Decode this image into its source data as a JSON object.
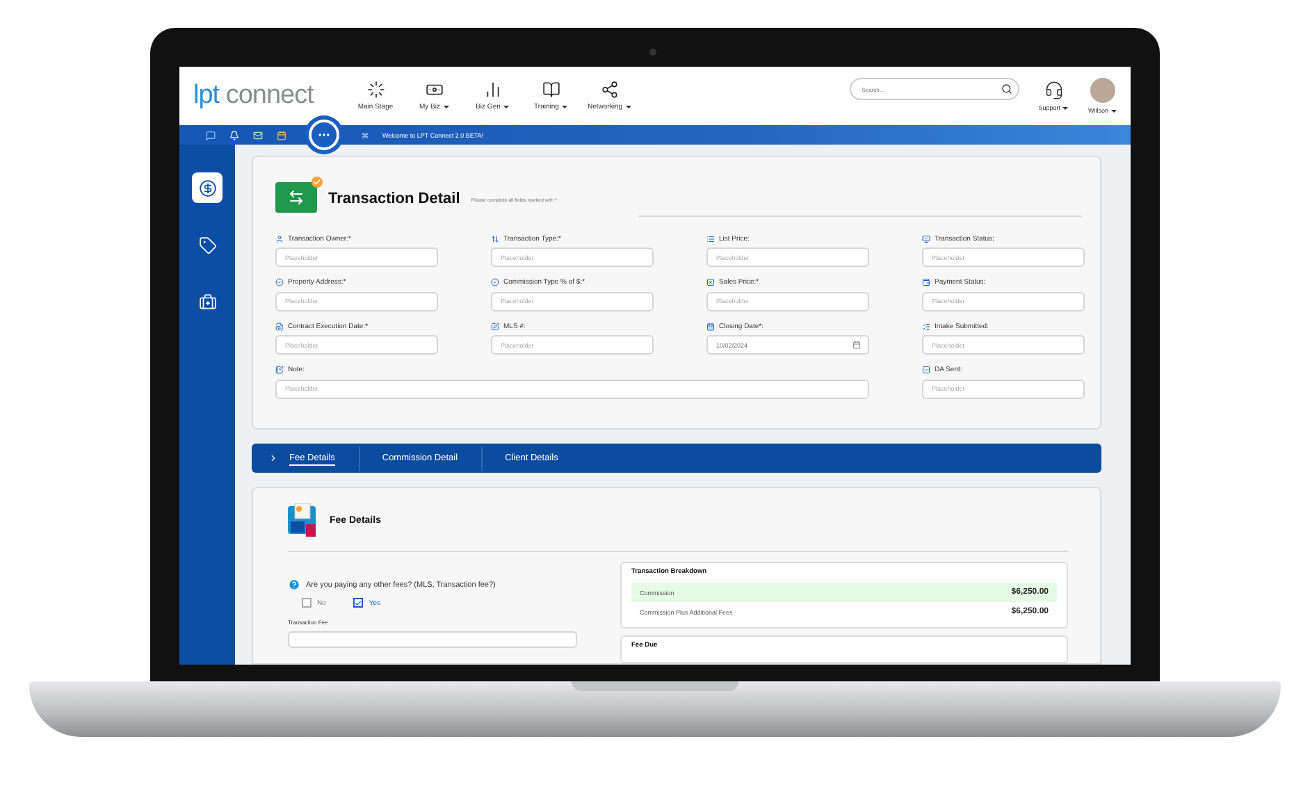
{
  "logo": {
    "prefix": "lpt",
    "name": "connect"
  },
  "nav": [
    {
      "label": "Main Stage",
      "has_menu": false
    },
    {
      "label": "My Biz",
      "has_menu": true
    },
    {
      "label": "Biz Gen",
      "has_menu": true
    },
    {
      "label": "Training",
      "has_menu": true
    },
    {
      "label": "Networking",
      "has_menu": true
    }
  ],
  "search": {
    "placeholder": "Search..."
  },
  "support": {
    "label": "Support"
  },
  "user": {
    "name": "Willson"
  },
  "welcome": "Welcome to LPT Connect 2.0 BETA!",
  "sidebar": [
    {
      "selected": true
    },
    {
      "selected": false
    },
    {
      "selected": false
    }
  ],
  "transaction_detail": {
    "title": "Transaction Detail",
    "note": "Please complete all fields marked with *",
    "columns": [
      [
        {
          "label": "Transaction Owner:*",
          "placeholder": "Placeholder"
        },
        {
          "label": "Property Address:*",
          "placeholder": "Placeholder"
        },
        {
          "label": "Contract Execution Date:*",
          "placeholder": "Placeholder"
        }
      ],
      [
        {
          "label": "Transaction Type:*",
          "placeholder": "Placeholder"
        },
        {
          "label": "Commission Type % of $:*",
          "placeholder": "Placeholder"
        },
        {
          "label": "MLS #:",
          "placeholder": "Placeholder"
        }
      ],
      [
        {
          "label": "List Price:",
          "kind": "text",
          "placeholder": "Placeholder"
        },
        {
          "label": "Sales Price:*",
          "kind": "text",
          "placeholder": "Placeholder"
        },
        {
          "label": "Closing Date*:",
          "kind": "date",
          "value": "10/02/2024"
        }
      ],
      [
        {
          "label": "Transaction Status:",
          "placeholder": "Placeholder"
        },
        {
          "label": "Payment Status:",
          "placeholder": "Placeholder"
        },
        {
          "label": "Intake Submitted:",
          "placeholder": "Placeholder"
        },
        {
          "label": "DA Sent:",
          "placeholder": "Placeholder"
        }
      ]
    ],
    "note_field": {
      "label": "Note:",
      "placeholder": "Placeholder"
    }
  },
  "tabs": [
    {
      "label": "Fee Details",
      "selected": true
    },
    {
      "label": "Commission Detail",
      "selected": false
    },
    {
      "label": "Client Details",
      "selected": false
    }
  ],
  "fee_details": {
    "title": "Fee Details",
    "question": "Are you paying any other fees? (MLS, Transaction fee?)",
    "options": [
      {
        "label": "No",
        "checked": false
      },
      {
        "label": "Yes",
        "checked": true
      }
    ],
    "transaction_fee_label": "Transaction Fee",
    "breakdown": {
      "title": "Transaction Breakdown",
      "rows": [
        {
          "label": "Commission",
          "amount": "$6,250.00",
          "highlighted": true
        },
        {
          "label": "Commission Plus Additional Fees",
          "amount": "$6,250.00",
          "highlighted": false
        }
      ]
    },
    "fee_due_title": "Fee Due"
  }
}
